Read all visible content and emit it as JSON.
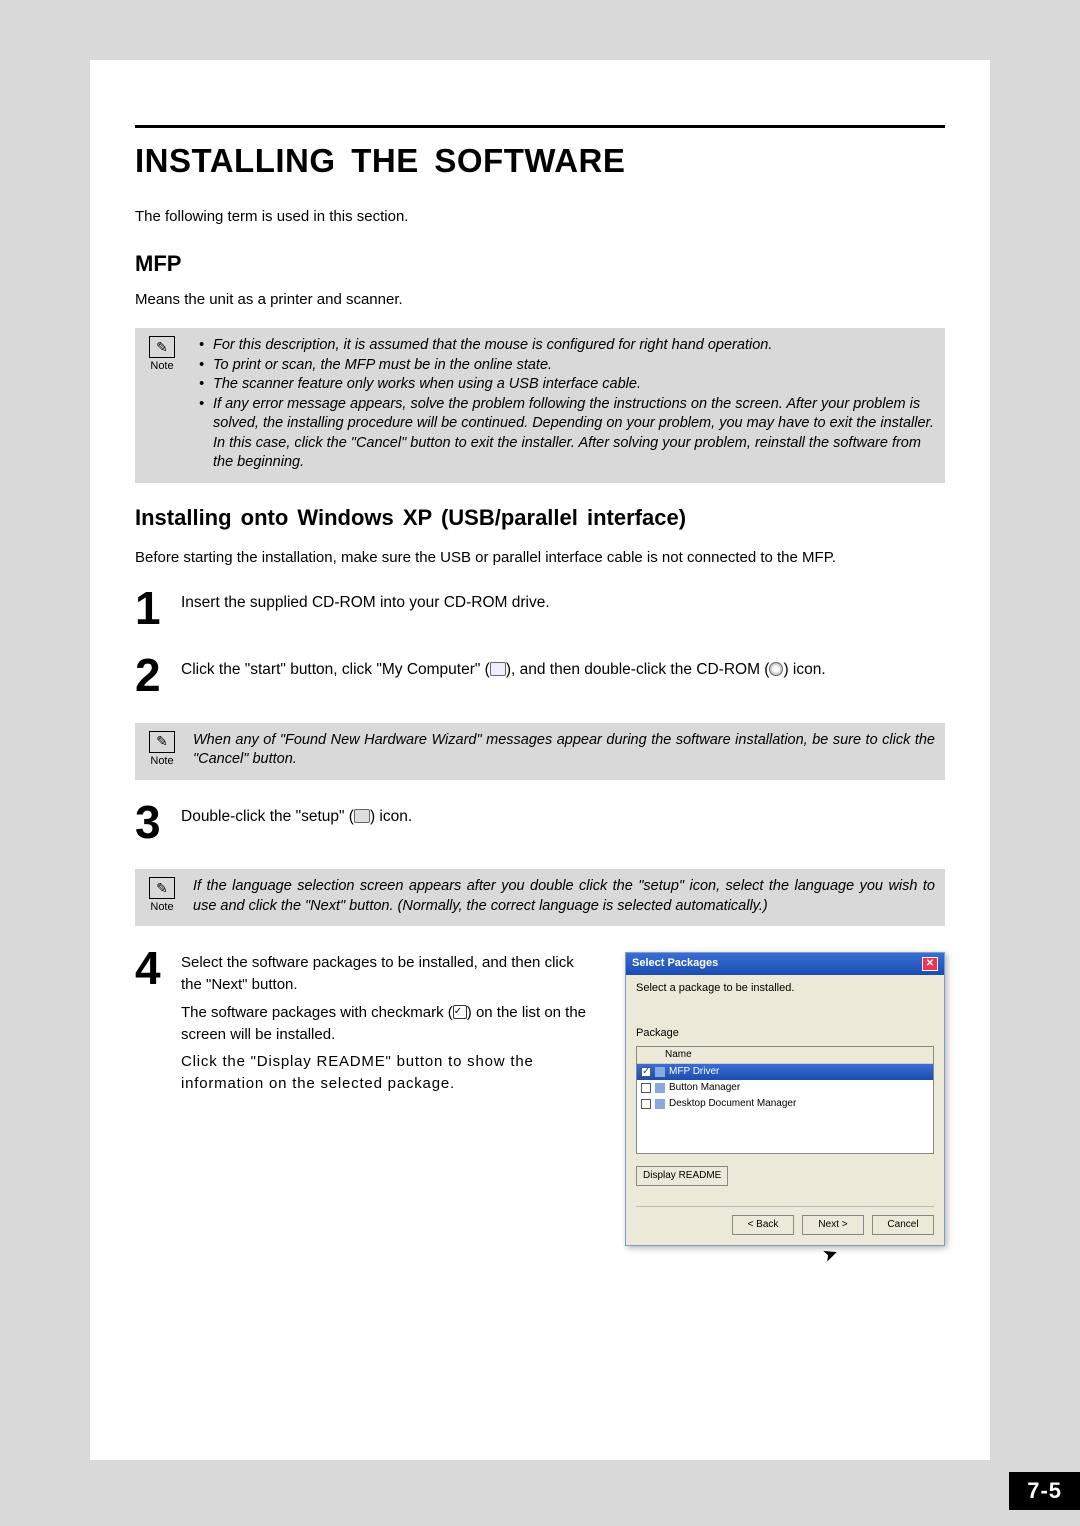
{
  "title": "INSTALLING THE SOFTWARE",
  "intro": "The following term is used in this section.",
  "mfp_heading": "MFP",
  "mfp_def": "Means the unit as a printer and scanner.",
  "note_label": "Note",
  "note1_items": [
    "For this description, it is assumed that the mouse is configured for right hand operation.",
    "To print or scan, the MFP must be in the online state.",
    "The scanner feature only works when using a USB interface cable.",
    "If any error message appears, solve the problem following the instructions on the screen. After your problem is solved, the installing procedure will be continued. Depending on your problem, you may have to exit the installer. In this case, click the \"Cancel\" button to exit the installer. After solving your problem, reinstall the software from the beginning."
  ],
  "section_heading": "Installing onto Windows XP (USB/parallel interface)",
  "section_lead": "Before starting the installation, make sure the USB or parallel interface cable is not connected to the MFP.",
  "steps": {
    "s1": "Insert the supplied CD-ROM into your CD-ROM drive.",
    "s2a": "Click the \"start\" button, click \"My Computer\" (",
    "s2b": "), and then double-click the CD-ROM (",
    "s2c": ") icon.",
    "s3a": "Double-click the \"setup\" (",
    "s3b": ") icon.",
    "s4a": "Select the software packages to be installed, and then click the \"Next\" button.",
    "s4b_a": "The software packages with checkmark (",
    "s4b_b": ") on the list on the screen will be installed.",
    "s4c": "Click the \"Display README\" button to show the information on the selected package."
  },
  "nums": {
    "n1": "1",
    "n2": "2",
    "n3": "3",
    "n4": "4"
  },
  "note2_text": "When any of \"Found New Hardware Wizard\" messages appear during the software installation, be sure to click the \"Cancel\" button.",
  "note3_text": "If the language selection screen appears after you double click the \"setup\" icon, select the language you wish to use and click the \"Next\" button. (Normally, the correct language is selected automatically.)",
  "dialog": {
    "title": "Select Packages",
    "instruction": "Select a package to be installed.",
    "pkg_label": "Package",
    "col_name": "Name",
    "items": [
      "MFP Driver",
      "Button Manager",
      "Desktop Document Manager"
    ],
    "display_readme": "Display README",
    "back": "< Back",
    "next": "Next >",
    "cancel": "Cancel",
    "check_glyph": "✓"
  },
  "page_number": "7-5"
}
